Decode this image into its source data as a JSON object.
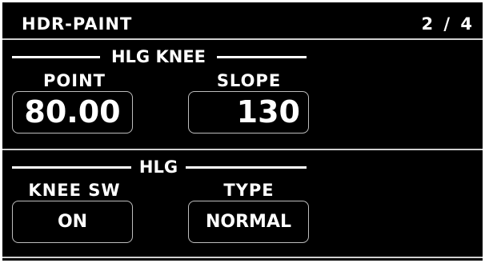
{
  "header": {
    "title": "HDR-PAINT",
    "page_indicator": "2 / 4"
  },
  "hlg_knee": {
    "group_title": "HLG KNEE",
    "point": {
      "label": "POINT",
      "value": "80.00"
    },
    "slope": {
      "label": "SLOPE",
      "value": "130"
    }
  },
  "hlg": {
    "group_title": "HLG",
    "knee_sw": {
      "label": "KNEE SW",
      "value": "ON"
    },
    "type": {
      "label": "TYPE",
      "value": "NORMAL"
    }
  },
  "colors": {
    "background": "#000000",
    "text": "#ffffff",
    "divider": "#cfcfcf",
    "box_border": "#bdbdbd"
  }
}
